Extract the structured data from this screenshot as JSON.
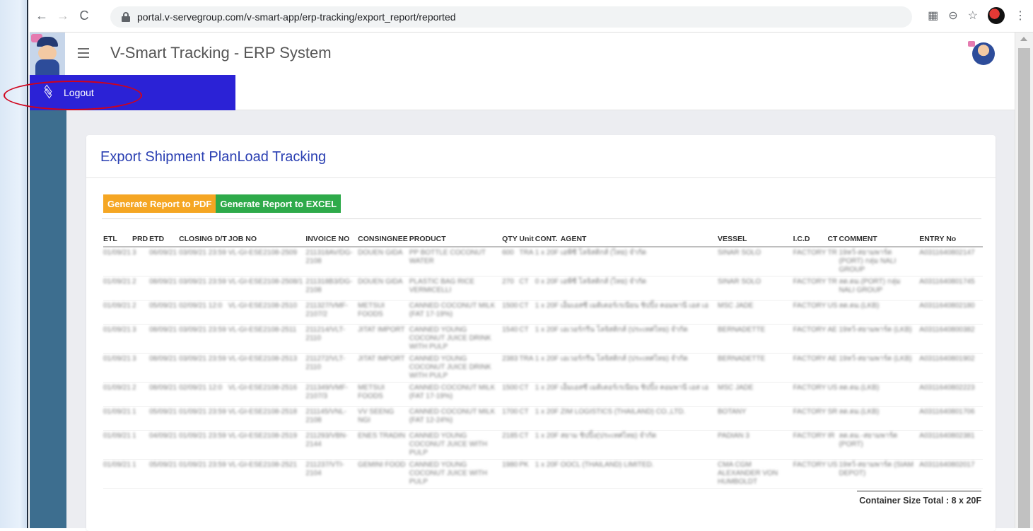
{
  "browser": {
    "url": "portal.v-servegroup.com/v-smart-app/erp-tracking/export_report/reported",
    "back": "←",
    "forward": "→",
    "reload": "C",
    "zoom": "⊖",
    "star": "☆",
    "menu": "⋮",
    "qr": "▦"
  },
  "app": {
    "title": "V-Smart Tracking - ERP System",
    "logout_label": "Logout"
  },
  "card": {
    "title": "Export Shipment PlanLoad Tracking",
    "btn_pdf": "Generate Report to PDF",
    "btn_excel": "Generate Report to EXCEL",
    "total": "Container Size Total : 8 x 20F"
  },
  "table": {
    "headers": [
      "ETL",
      "PRD",
      "ETD",
      "CLOSING D/T",
      "JOB NO",
      "INVOICE NO",
      "CONSINGNEE",
      "PRODUCT",
      "QTY",
      "Unit",
      "CONT.",
      "AGENT",
      "VESSEL",
      "I.C.D",
      "CT",
      "COMMENT",
      "ENTRY No"
    ],
    "rows": [
      [
        "01/09/21",
        "3",
        "06/09/21",
        "03/09/21 23:59",
        "VL-GI-ESE2108-2509",
        "211318AV/DG-2108",
        "DOUEN GIDA",
        "PP BOTTLE COCONUT WATER",
        "600",
        "TRA",
        "1 x 20F",
        "เอพีซี โลจิสติกส์ (ไทย) จำกัด",
        "SINAR SOLO",
        "FACTORY",
        "TR",
        "19หว้-สยามพาร์ต (PORT) กลุ่ม NALI GROUP",
        "A0311640802147"
      ],
      [
        "01/09/21",
        "2",
        "08/09/21",
        "03/09/21 23:59",
        "VL-GI-ESE2108-2508/1",
        "211318B3/DG-2108",
        "DOUEN GIDA",
        "PLASTIC BAG RICE VERMICELLI",
        "270",
        "CT",
        "0 x 20F",
        "เอพีซี โลจิสติกส์ (ไทย) จำกัด",
        "SINAR SOLO",
        "FACTORY",
        "TR",
        "ลด.ดม.(PORT) กลุ่ม NALI GROUP",
        "A0311640801745"
      ],
      [
        "01/09/21",
        "2",
        "05/09/21",
        "02/09/21 12:0",
        "VL-GI-ESE2108-2510",
        "211327/VMF-2107/2",
        "METSUI FOODS",
        "CANNED COCONUT MILK (FAT 17-19%)",
        "1500",
        "CT",
        "1 x 20F",
        "เอ็มเอสซี เมดิเตอร์เรเนียน ชิปปิ้ง คอมพานี เอส เอ",
        "MSC JADE",
        "FACTORY",
        "US",
        "ลด.ดม.(LKB)",
        "A0311640802180"
      ],
      [
        "01/09/21",
        "3",
        "08/09/21",
        "03/09/21 23:59",
        "VL-GI-ESE2108-2511",
        "211214/VLT-2110",
        "JITAT IMPORT",
        "CANNED YOUNG COCONUT JUICE DRINK WITH PULP",
        "1540",
        "CT",
        "1 x 20F",
        "เอเวอร์กรีน โลจิสติกส์ (ประเทศไทย) จำกัด",
        "BERNADETTE",
        "FACTORY",
        "AE",
        "19หว้-สยามพาร์ต (LKB)",
        "A0311640800382"
      ],
      [
        "01/09/21",
        "3",
        "08/09/21",
        "03/09/21 23:59",
        "VL-GI-ESE2108-2513",
        "211272/VLT-2110",
        "JITAT IMPORT",
        "CANNED YOUNG COCONUT JUICE DRINK WITH PULP",
        "2383",
        "TRA",
        "1 x 20F",
        "เอเวอร์กรีน โลจิสติกส์ (ประเทศไทย) จำกัด",
        "BERNADETTE",
        "FACTORY",
        "AE",
        "19หว้-สยามพาร์ต (LKB)",
        "A0311640801902"
      ],
      [
        "01/09/21",
        "2",
        "08/09/21",
        "02/09/21 12:0",
        "VL-GI-ESE2108-2516",
        "211349/VMF-2107/3",
        "METSUI FOODS",
        "CANNED COCONUT MILK (FAT 17-19%)",
        "1500",
        "CT",
        "1 x 20F",
        "เอ็มเอสซี เมดิเตอร์เรเนียน ชิปปิ้ง คอมพานี เอส เอ",
        "MSC JADE",
        "FACTORY",
        "US",
        "ลด.ดม.(LKB)",
        "A0311640802223"
      ],
      [
        "01/09/21",
        "1",
        "05/09/21",
        "01/09/21 23:59",
        "VL-GI-ESE2108-2518",
        "211145/VNL-2108",
        "VV SEENG NGI",
        "CANNED COCONUT MILK (FAT 12-24%)",
        "1700",
        "CT",
        "1 x 20F",
        "ZIM LOGISTICS (THAILAND) CO.,LTD.",
        "BOTANY",
        "FACTORY",
        "SR",
        "ลด.ดม.(LKB)",
        "A0311640801706"
      ],
      [
        "01/09/21",
        "1",
        "04/09/21",
        "01/09/21 23:59",
        "VL-GI-ESE2108-2519",
        "211293/VBN-2144",
        "ENES TRADIN",
        "CANNED YOUNG COCONUT JUICE WITH PULP",
        "2185",
        "CT",
        "1 x 20F",
        "สยาม ชิปปิ้ง(ประเทศไทย) จำกัด",
        "PADIAN 3",
        "FACTORY",
        "IR",
        "ลด.ดม.-สยามพาร์ต (PORT)",
        "A0311640802381"
      ],
      [
        "01/09/21",
        "1",
        "05/09/21",
        "01/09/21 23:59",
        "VL-GI-ESE2108-2521",
        "211237/VTI-2104",
        "GEMINI FOOD",
        "CANNED YOUNG COCONUT JUICE WITH PULP",
        "1980",
        "PK",
        "1 x 20F",
        "OOCL (THAILAND) LIMITED.",
        "CMA CGM ALEXANDER VON HUMBOLDT",
        "FACTORY",
        "US",
        "19หว้-สยามพาร์ต (SIAM DEPOT)",
        "A0311640802017"
      ]
    ]
  },
  "colors": {
    "accent_blue": "#2b22d6",
    "title_blue": "#2a3fb2",
    "pdf_orange": "#f5a623",
    "excel_green": "#2eaa4a",
    "sidebar": "#3d6e8f",
    "highlight_red": "#d0021b"
  }
}
